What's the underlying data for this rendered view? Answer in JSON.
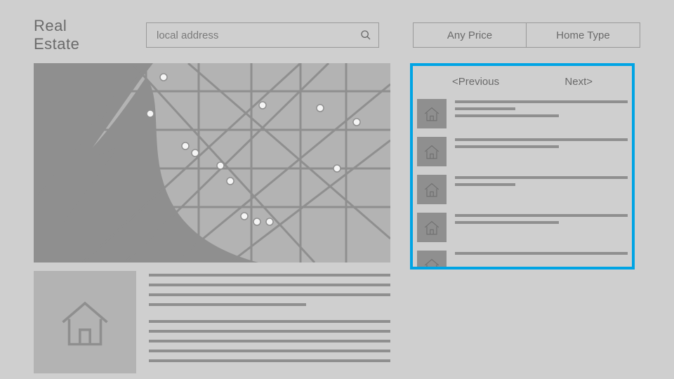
{
  "header": {
    "brand": "Real Estate",
    "search_placeholder": "local address",
    "filter_price": "Any Price",
    "filter_type": "Home Type"
  },
  "sidepanel": {
    "prev": "<Previous",
    "next": "Next>",
    "listings": [
      {
        "icon": "home"
      },
      {
        "icon": "home"
      },
      {
        "icon": "home"
      },
      {
        "icon": "home"
      },
      {
        "icon": "home"
      }
    ]
  },
  "detail": {
    "icon": "home"
  },
  "colors": {
    "highlight": "#00a4e4",
    "bg": "#cfcfcf",
    "map_bg": "#b3b3b3",
    "dark": "#8f8f8f"
  }
}
